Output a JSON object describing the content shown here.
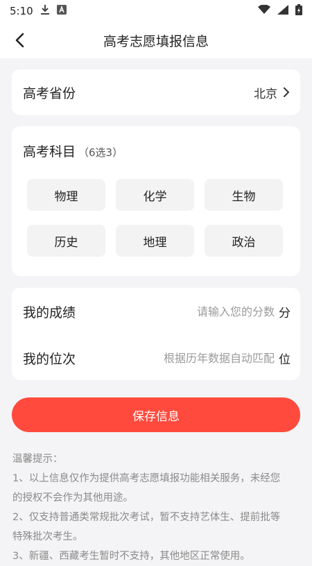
{
  "status_bar": {
    "time": "5:10",
    "icons": [
      "download-icon",
      "a-badge-icon",
      "wifi-icon",
      "signal-icon",
      "battery-icon"
    ]
  },
  "nav": {
    "title": "高考志愿填报信息",
    "back_icon": "back-chevron-icon"
  },
  "province": {
    "label": "高考省份",
    "value": "北京"
  },
  "subjects": {
    "title": "高考科目",
    "hint": "（6选3）",
    "options": [
      "物理",
      "化学",
      "生物",
      "历史",
      "地理",
      "政治"
    ]
  },
  "score": {
    "score_label": "我的成绩",
    "score_placeholder": "请输入您的分数",
    "score_unit": "分",
    "rank_label": "我的位次",
    "rank_placeholder": "根据历年数据自动匹配",
    "rank_unit": "位"
  },
  "save_button": "保存信息",
  "tips": {
    "title": "温馨提示：",
    "lines": [
      "1、以上信息仅作为提供高考志愿填报功能相关服务，未经您",
      "的授权不会作为其他用途。",
      "2、仅支持普通类常规批次考试，暂不支持艺体生、提前批等",
      "特殊批次考生。",
      "3、新疆、西藏考生暂时不支持，其他地区正常使用。"
    ]
  },
  "colors": {
    "accent": "#ff4a3d",
    "background": "#f4f4f6",
    "card": "#ffffff",
    "chip": "#f3f3f3"
  }
}
